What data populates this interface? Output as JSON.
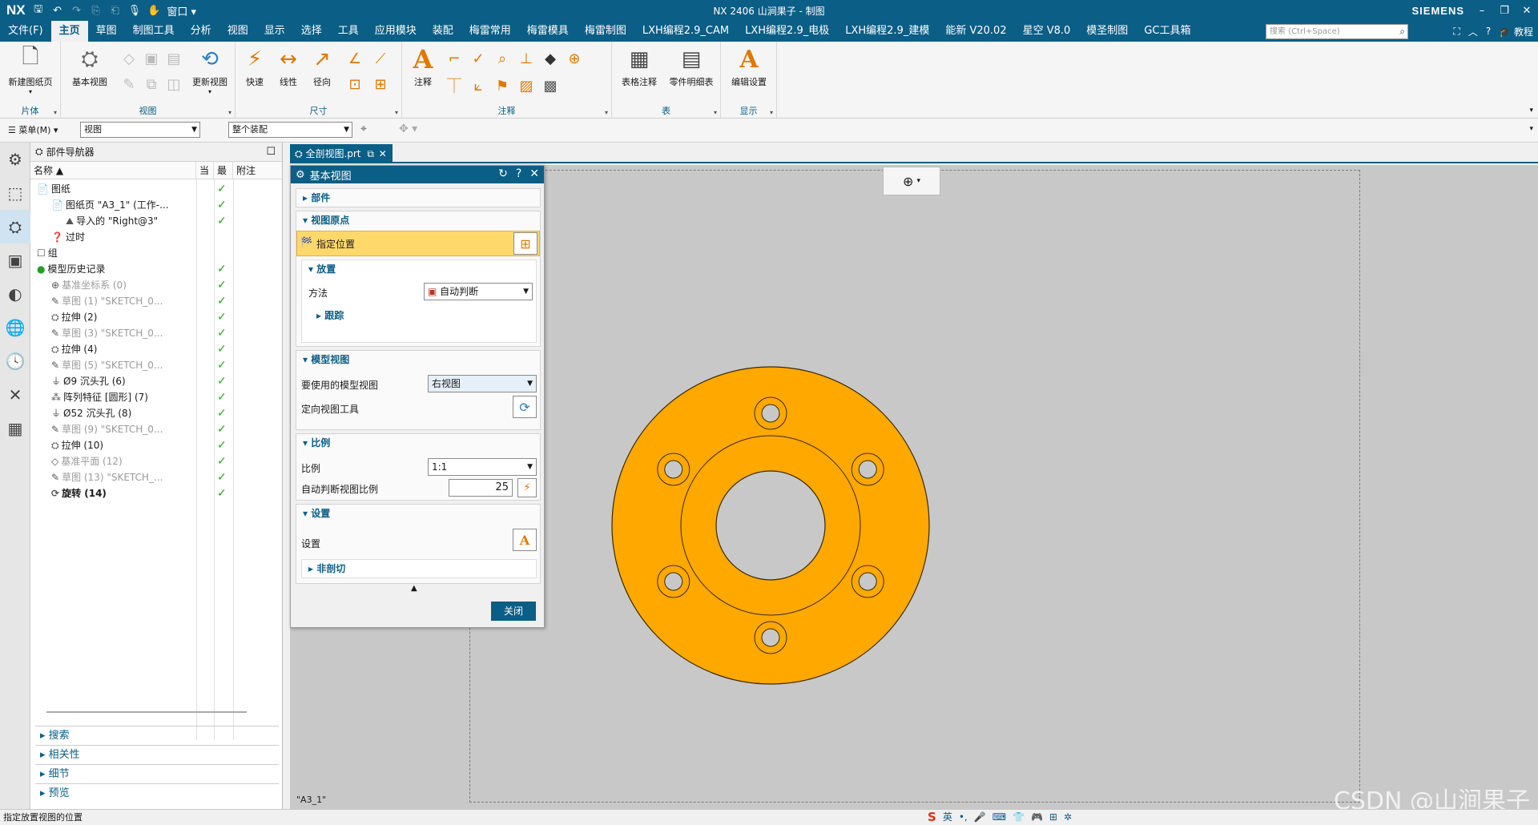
{
  "titlebar": {
    "logo": "NX",
    "title": "NX 2406 山涧果子 - 制图",
    "brand": "SIEMENS",
    "window_menu": "窗口"
  },
  "menubar": {
    "items": [
      "文件(F)",
      "主页",
      "草图",
      "制图工具",
      "分析",
      "视图",
      "显示",
      "选择",
      "工具",
      "应用模块",
      "装配",
      "梅雷常用",
      "梅雷模具",
      "梅雷制图",
      "LXH编程2.9_CAM",
      "LXH编程2.9_电极",
      "LXH编程2.9_建模",
      "能新 V20.02",
      "星空 V8.0",
      "模圣制图",
      "GC工具箱"
    ],
    "search_placeholder": "搜索 (Ctrl+Space)",
    "tutorial": "教程"
  },
  "ribbon": {
    "groups": {
      "sheet": "片体",
      "view": "视图",
      "dimension": "尺寸",
      "annotation": "注释",
      "table": "表",
      "display": "显示"
    },
    "buttons": {
      "new_sheet": "新建图纸页",
      "base_view": "基本视图",
      "update_view": "更新视图",
      "quick": "快速",
      "linear": "线性",
      "radial": "径向",
      "note": "注释",
      "table_note": "表格注释",
      "parts_list": "零件明细表",
      "edit_settings": "编辑设置"
    }
  },
  "toolbar2": {
    "menu_label": "菜单(M)",
    "filter_value": "视图",
    "assembly_value": "整个装配"
  },
  "navigator": {
    "title": "部件导航器",
    "columns": [
      "名称",
      "当",
      "最",
      "附注"
    ],
    "rows": [
      {
        "label": "图纸",
        "indent": 0,
        "check": true,
        "style": ""
      },
      {
        "label": "图纸页 \"A3_1\" (工作-...",
        "indent": 1,
        "check": true,
        "style": ""
      },
      {
        "label": "导入的 \"Right@3\"",
        "indent": 2,
        "check": true,
        "style": ""
      },
      {
        "label": "过时",
        "indent": 1,
        "check": false,
        "style": ""
      },
      {
        "label": "组",
        "indent": 0,
        "check": false,
        "style": ""
      },
      {
        "label": "模型历史记录",
        "indent": 0,
        "check": true,
        "style": ""
      },
      {
        "label": "基准坐标系 (0)",
        "indent": 1,
        "check": true,
        "style": "dim"
      },
      {
        "label": "草图 (1) \"SKETCH_0...",
        "indent": 1,
        "check": true,
        "style": "dim"
      },
      {
        "label": "拉伸 (2)",
        "indent": 1,
        "check": true,
        "style": ""
      },
      {
        "label": "草图 (3) \"SKETCH_0...",
        "indent": 1,
        "check": true,
        "style": "dim"
      },
      {
        "label": "拉伸 (4)",
        "indent": 1,
        "check": true,
        "style": ""
      },
      {
        "label": "草图 (5) \"SKETCH_0...",
        "indent": 1,
        "check": true,
        "style": "dim"
      },
      {
        "label": "Ø9 沉头孔 (6)",
        "indent": 1,
        "check": true,
        "style": ""
      },
      {
        "label": "阵列特征 [圆形] (7)",
        "indent": 1,
        "check": true,
        "style": ""
      },
      {
        "label": "Ø52 沉头孔 (8)",
        "indent": 1,
        "check": true,
        "style": ""
      },
      {
        "label": "草图 (9) \"SKETCH_0...",
        "indent": 1,
        "check": true,
        "style": "dim"
      },
      {
        "label": "拉伸 (10)",
        "indent": 1,
        "check": true,
        "style": ""
      },
      {
        "label": "基准平面 (12)",
        "indent": 1,
        "check": true,
        "style": "dim"
      },
      {
        "label": "草图 (13) \"SKETCH_...",
        "indent": 1,
        "check": true,
        "style": "dim"
      },
      {
        "label": "旋转 (14)",
        "indent": 1,
        "check": true,
        "style": "bold"
      }
    ],
    "bottom_sections": [
      "搜索",
      "相关性",
      "细节",
      "预览"
    ]
  },
  "tab": {
    "label": "全剖视图.prt"
  },
  "dialog": {
    "title": "基本视图",
    "sections": {
      "part": "部件",
      "view_origin": "视图原点",
      "placement": "放置",
      "tracking": "跟踪",
      "model_view": "模型视图",
      "scale": "比例",
      "settings": "设置",
      "non_section": "非剖切"
    },
    "specify_location": "指定位置",
    "method_label": "方法",
    "method_value": "自动判断",
    "model_view_label": "要使用的模型视图",
    "model_view_value": "右视图",
    "orient_tool_label": "定向视图工具",
    "scale_label": "比例",
    "scale_value": "1:1",
    "auto_scale_label": "自动判断视图比例",
    "auto_scale_value": "25",
    "settings_label": "设置",
    "close": "关闭"
  },
  "canvas": {
    "sheet_name": "\"A3_1\"",
    "part_color": "#ffa800"
  },
  "status": {
    "message": "指定放置视图的位置",
    "ime": [
      "S",
      "英",
      "•,",
      "🎤",
      "⌨",
      "👕",
      "🎮",
      "⊞",
      "✲"
    ]
  },
  "watermark": "CSDN @山涧果子"
}
